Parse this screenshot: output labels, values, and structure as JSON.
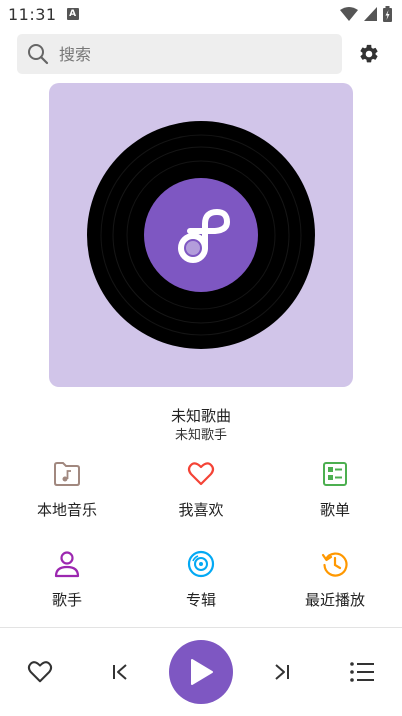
{
  "status_bar": {
    "time": "11:31",
    "notification_badge": "A"
  },
  "search": {
    "placeholder": "搜索",
    "icon": "search-icon"
  },
  "settings": {
    "icon": "gear-icon"
  },
  "album": {
    "background_color": "#d1c5e9",
    "label_color": "#7e57c2",
    "logo_icon": "music-note-logo"
  },
  "song": {
    "title": "未知歌曲",
    "artist": "未知歌手"
  },
  "grid": [
    {
      "label": "本地音乐",
      "icon": "folder-music-icon",
      "color": "#a1887f"
    },
    {
      "label": "我喜欢",
      "icon": "heart-icon",
      "color": "#f44336"
    },
    {
      "label": "歌单",
      "icon": "playlist-icon",
      "color": "#4caf50"
    },
    {
      "label": "歌手",
      "icon": "person-icon",
      "color": "#9c27b0"
    },
    {
      "label": "专辑",
      "icon": "disc-icon",
      "color": "#03a9f4"
    },
    {
      "label": "最近播放",
      "icon": "history-icon",
      "color": "#ff9800"
    }
  ],
  "player": {
    "favorite_icon": "heart-outline-icon",
    "previous_icon": "skip-previous-icon",
    "play_icon": "play-icon",
    "next_icon": "skip-next-icon",
    "queue_icon": "list-icon",
    "accent_color": "#7e57c2"
  }
}
